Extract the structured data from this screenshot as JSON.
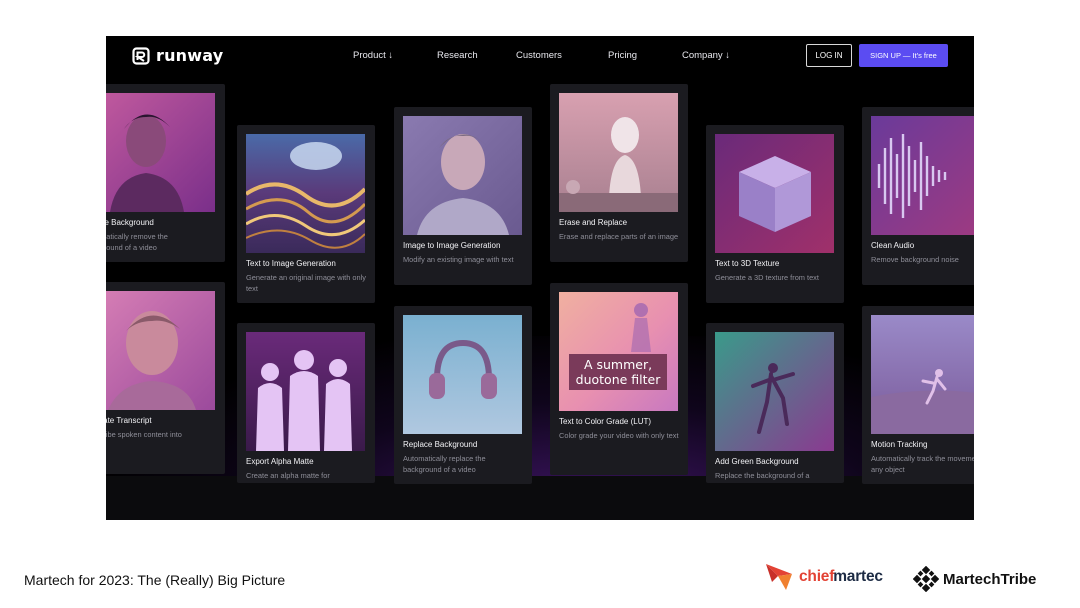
{
  "nav": {
    "brand": "runway",
    "links": [
      "Product ↓",
      "Research",
      "Customers",
      "Pricing",
      "Company ↓"
    ],
    "login": "LOG IN",
    "signup": "SIGN UP — It's free"
  },
  "cards": [
    {
      "title": "ove Background",
      "desc": "omatically remove the\nkground of a video",
      "icon": "portrait-thumbnail"
    },
    {
      "title": "erate Transcript",
      "desc": "scribe spoken content into",
      "icon": "portrait-thumbnail"
    },
    {
      "title": "Text to Image Generation",
      "desc": "Generate an original image with only text",
      "icon": "abstract-waves-thumbnail"
    },
    {
      "title": "Export Alpha Matte",
      "desc": "Create an alpha matte for",
      "icon": "silhouettes-thumbnail"
    },
    {
      "title": "Image to Image Generation",
      "desc": "Modify an existing image with text",
      "icon": "portrait-thumbnail"
    },
    {
      "title": "Replace Background",
      "desc": "Automatically replace the background of a video",
      "icon": "headphones-thumbnail"
    },
    {
      "title": "Erase and Replace",
      "desc": "Erase and replace parts of an image",
      "icon": "bust-statue-thumbnail"
    },
    {
      "title": "Text to Color Grade (LUT)",
      "desc": "Color grade your video with only text",
      "icon": "color-grade-thumbnail",
      "overlay": "A summer,\nduotone filter"
    },
    {
      "title": "Text to 3D Texture",
      "desc": "Generate a 3D texture from text",
      "icon": "cube-thumbnail"
    },
    {
      "title": "Add Green Background",
      "desc": "Replace the background of a",
      "icon": "dancer-thumbnail"
    },
    {
      "title": "Clean Audio",
      "desc": "Remove background noise",
      "icon": "waveform-thumbnail"
    },
    {
      "title": "Motion Tracking",
      "desc": "Automatically track the movement of any object",
      "icon": "skater-thumbnail"
    }
  ],
  "footer": {
    "title": "Martech for 2023: The (Really) Big Picture",
    "logo1_a": "chief",
    "logo1_b": "martec",
    "logo2": "MartechTribe"
  },
  "colors": {
    "signup": "#5b4cf2",
    "chiefmartec_red": "#e34234",
    "chiefmartec_navy": "#1d2b44"
  }
}
